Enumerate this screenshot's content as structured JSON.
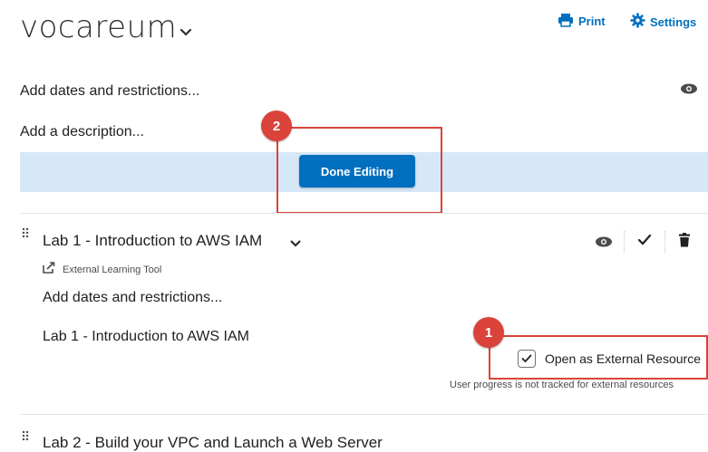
{
  "header": {
    "title": "vocareum",
    "print_label": "Print",
    "settings_label": "Settings"
  },
  "module": {
    "add_dates": "Add dates and restrictions...",
    "add_description": "Add a description...",
    "done_editing": "Done Editing"
  },
  "callouts": [
    "1",
    "2"
  ],
  "item": {
    "title": "Lab 1 - Introduction to AWS IAM",
    "type_label": "External Learning Tool",
    "add_dates": "Add dates and restrictions...",
    "link_text": "Lab 1 - Introduction to AWS IAM",
    "external_checkbox_label": "Open as External Resource",
    "external_checked": true,
    "external_note": "User progress is not tracked for external resources"
  },
  "next_item": {
    "title_partial": "Lab 2 - Build your VPC and Launch a Web Server"
  },
  "colors": {
    "accent": "#006fbf",
    "band": "#d6e8f8",
    "callout": "#d9433a"
  }
}
